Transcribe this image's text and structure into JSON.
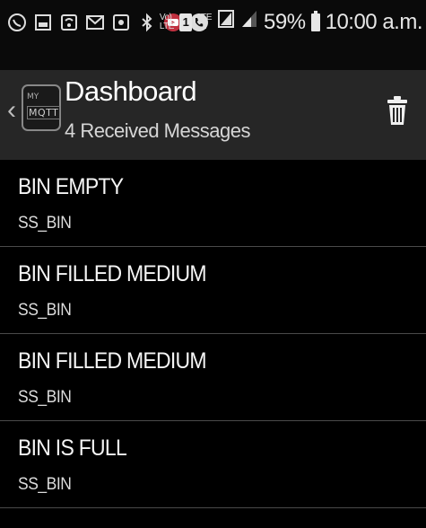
{
  "status_bar": {
    "icons": [
      "whatsapp-icon",
      "gallery-icon",
      "sim-icon",
      "gmail-icon",
      "screenshot-icon",
      "bluetooth-icon",
      "youtube-icon",
      "phone-icon"
    ],
    "volte_label": "Vo)\nLTE",
    "sim_badge": "1",
    "lte_label": "LTE",
    "battery_percent": "59%",
    "time": "10:00 a.m."
  },
  "header": {
    "logo_top": "MY",
    "logo_bottom": "MQTT",
    "title": "Dashboard",
    "subtitle": "4 Received Messages"
  },
  "messages": [
    {
      "title": "BIN EMPTY",
      "topic": "SS_BIN"
    },
    {
      "title": "BIN FILLED MEDIUM",
      "topic": "SS_BIN"
    },
    {
      "title": "BIN FILLED MEDIUM",
      "topic": "SS_BIN"
    },
    {
      "title": "BIN IS FULL",
      "topic": "SS_BIN"
    }
  ],
  "colors": {
    "background": "#000000",
    "header": "#262626",
    "status_bar": "#0a0a0a",
    "divider": "#4a4a4a"
  }
}
